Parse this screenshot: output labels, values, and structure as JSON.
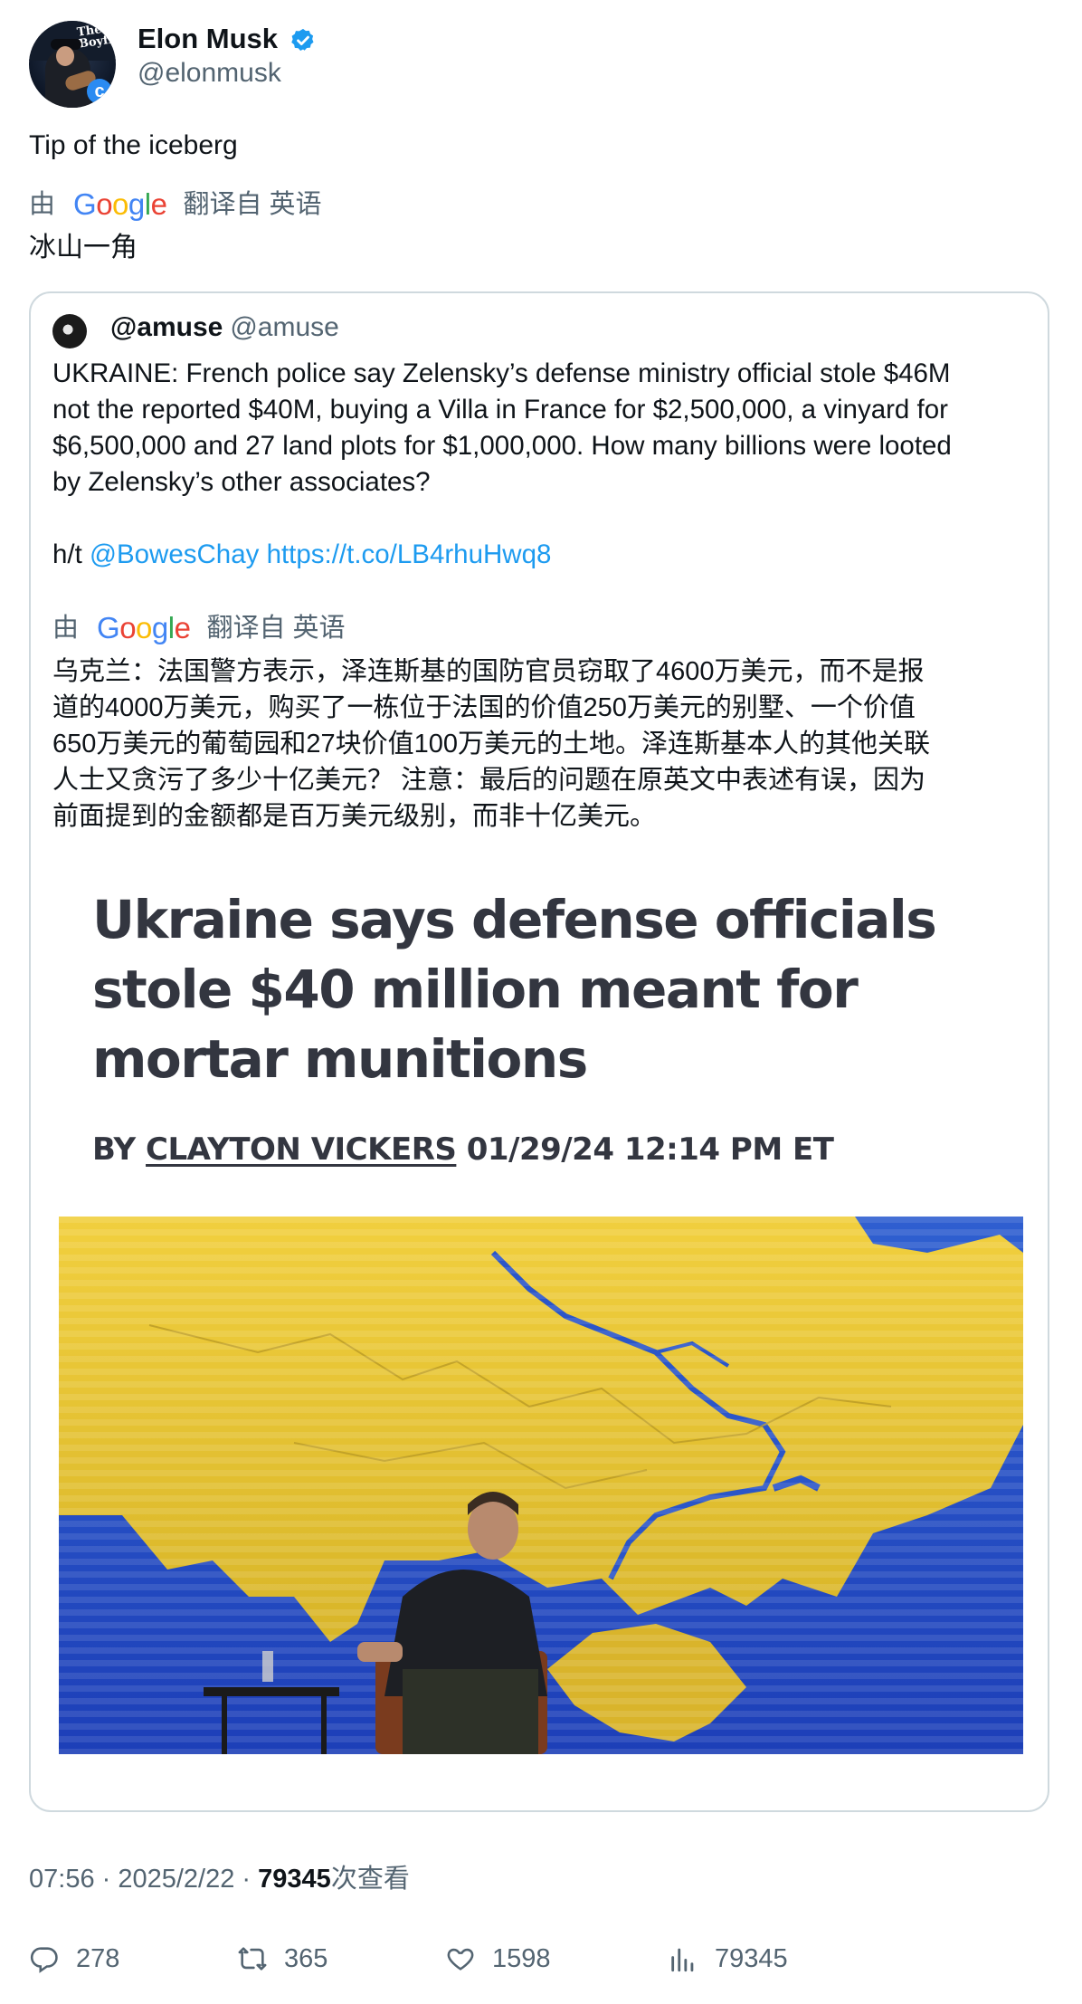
{
  "author": {
    "display_name": "Elon Musk",
    "handle": "@elonmusk",
    "verified_color": "#1d9bf0",
    "avatar_text": "The Boyfriend"
  },
  "tweet": {
    "text": "Tip of the iceberg",
    "translation": {
      "by": "由",
      "provider": "Google",
      "from": "翻译自 英语",
      "text": "冰山一角"
    }
  },
  "quote": {
    "display_name": "@amuse",
    "handle": "@amuse",
    "body_lines": [
      "UKRAINE: French police say Zelensky’s defense ministry official stole $46M",
      "not the reported $40M, buying a Villa in France for $2,500,000, a vinyard for",
      "$6,500,000 and 27 land plots for $1,000,000. How many billions were looted",
      "by Zelensky’s other associates?"
    ],
    "ht_prefix": "h/t",
    "mention": "@BowesChay",
    "url": "https://t.co/LB4rhuHwq8",
    "translation": {
      "by": "由",
      "provider": "Google",
      "from": "翻译自 英语",
      "lines": [
        "乌克兰：法国警方表示，泽连斯基的国防官员窃取了4600万美元，而不是报",
        "道的4000万美元，购买了一栋位于法国的价值250万美元的别墅、一个价值",
        "650万美元的葡萄园和27块价值100万美元的土地。泽连斯基本人的其他关联",
        "人士又贪污了多少十亿美元？ 注意：最后的问题在原英文中表述有误，因为",
        "前面提到的金额都是百万美元级别，而非十亿美元。"
      ]
    },
    "article": {
      "headline_lines": [
        "Ukraine says defense officials",
        "stole $40 million meant for",
        "mortar munitions"
      ],
      "byline_prefix": "BY",
      "byline_author": "CLAYTON VICKERS",
      "byline_date": "01/29/24 12:14 PM ET"
    }
  },
  "meta": {
    "time": "07:56",
    "date": "2025/2/22",
    "views": "79345",
    "views_label": "次查看"
  },
  "actions": {
    "replies": "278",
    "reposts": "365",
    "likes": "1598",
    "views": "79345"
  }
}
